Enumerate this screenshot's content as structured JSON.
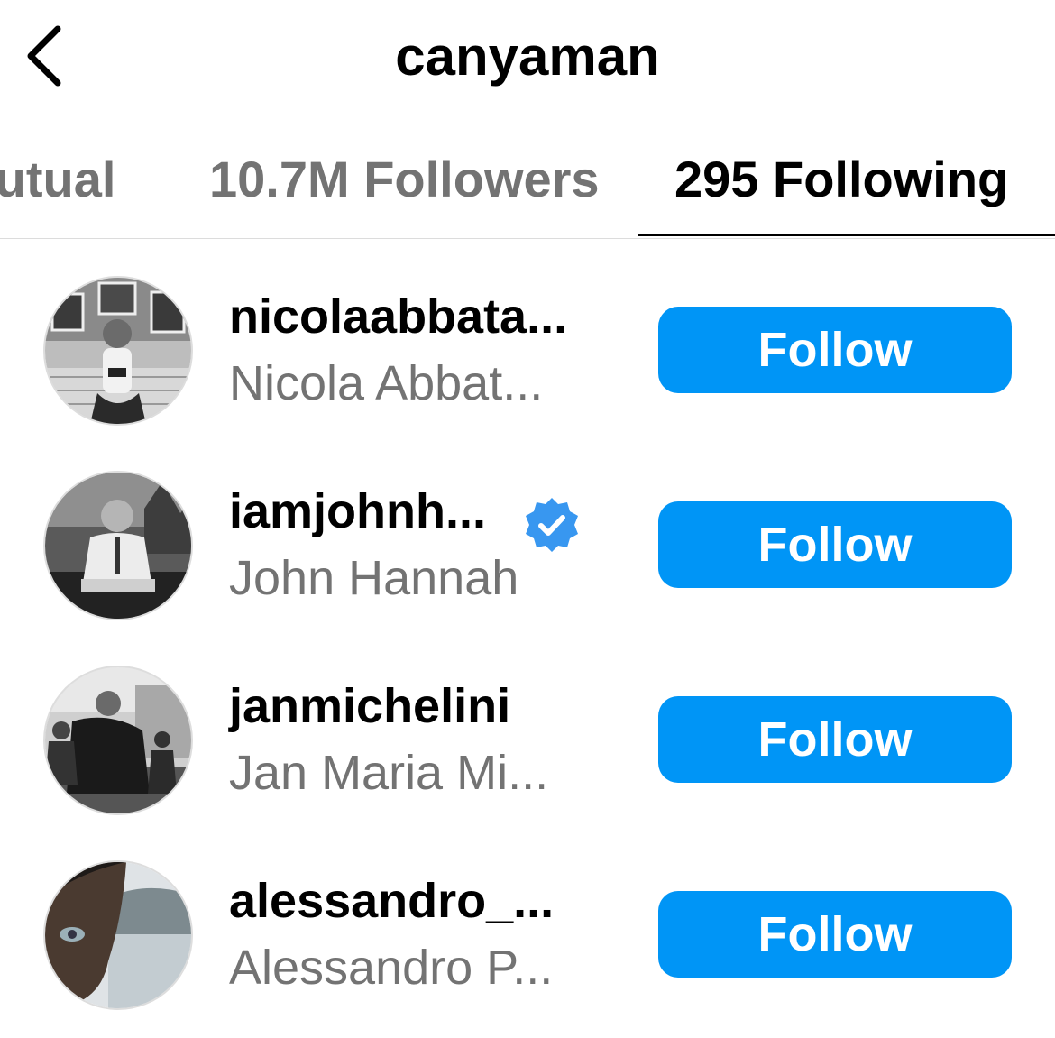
{
  "header": {
    "title": "canyaman",
    "back_icon": "chevron-left-icon"
  },
  "tabs": [
    {
      "label": "Mutual",
      "active": false
    },
    {
      "label": "10.7M Followers",
      "active": false
    },
    {
      "label": "295 Following",
      "active": true
    }
  ],
  "list": [
    {
      "username": "nicolaabbata...",
      "fullname": "Nicola Abbat...",
      "verified": false,
      "button": "Follow"
    },
    {
      "username": "iamjohnh...",
      "fullname": "John Hannah",
      "verified": true,
      "button": "Follow"
    },
    {
      "username": "janmichelini",
      "fullname": "Jan Maria Mi...",
      "verified": false,
      "button": "Follow"
    },
    {
      "username": "alessandro_...",
      "fullname": "Alessandro P...",
      "verified": false,
      "button": "Follow"
    }
  ],
  "colors": {
    "follow_button": "#0095f6",
    "verified_badge": "#3897f0",
    "secondary_text": "#737373"
  }
}
